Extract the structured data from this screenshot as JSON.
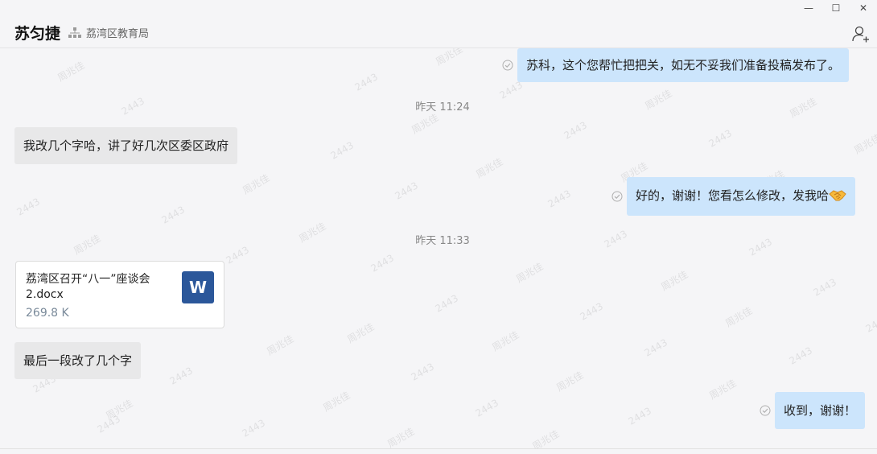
{
  "window": {
    "minimize_glyph": "—",
    "maximize_glyph": "☐",
    "close_glyph": "✕"
  },
  "header": {
    "contact_name": "苏匀捷",
    "org_icon": "org-chart-icon",
    "org_name": "荔湾区教育局",
    "add_member_icon": "add-user-icon"
  },
  "watermark": {
    "texts": [
      "周兆佳",
      "2443"
    ]
  },
  "messages": [
    {
      "direction": "out",
      "text": "苏科，这个您帮忙把把关，如无不妥我们准备投稿发布了。",
      "status_icon": "read-check-icon"
    },
    {
      "type": "timestamp",
      "text": "昨天 11:24"
    },
    {
      "direction": "in",
      "text": "我改几个字哈，讲了好几次区委区政府"
    },
    {
      "direction": "out",
      "text": "好的，谢谢！您看怎么修改，发我哈",
      "emoji": "handshake-emoji",
      "status_icon": "read-check-icon"
    },
    {
      "type": "timestamp",
      "text": "昨天 11:33"
    },
    {
      "direction": "in",
      "type": "file",
      "file_name": "荔湾区召开“八一”座谈会2.docx",
      "file_size": "269.8 K",
      "file_icon_label": "W"
    },
    {
      "direction": "in",
      "text": "最后一段改了几个字"
    },
    {
      "direction": "out",
      "text": "收到，谢谢！",
      "status_icon": "read-check-icon"
    }
  ],
  "colors": {
    "incoming_bubble": "#e8e8e9",
    "outgoing_bubble": "#cce5fc",
    "word_icon": "#2b579a"
  }
}
